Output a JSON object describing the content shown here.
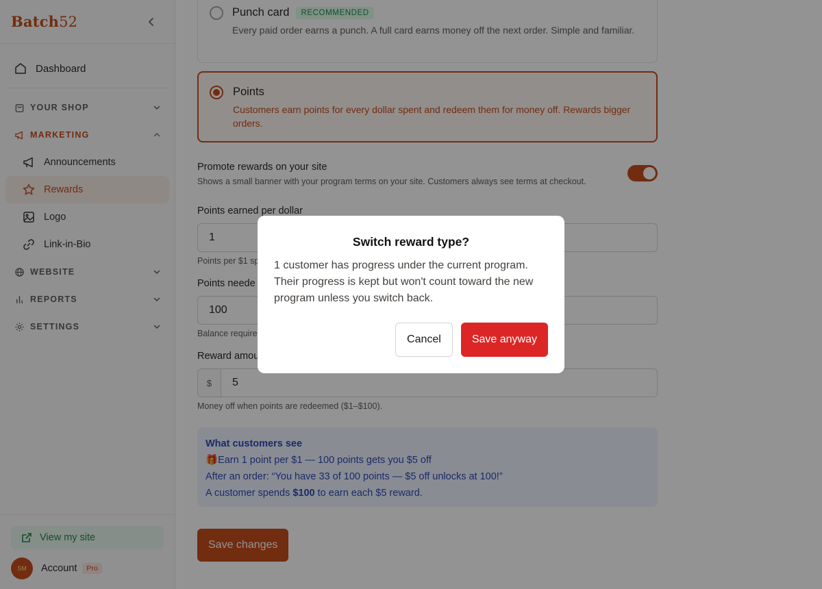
{
  "sidebar": {
    "brand": {
      "name": "Batch",
      "number": "52"
    },
    "dashboard_label": "Dashboard",
    "sections": {
      "your_shop": "YOUR SHOP",
      "marketing": "MARKETING",
      "website": "WEBSITE",
      "reports": "REPORTS",
      "settings": "SETTINGS"
    },
    "marketing_items": [
      "Announcements",
      "Rewards",
      "Logo",
      "Link-in-Bio"
    ],
    "active_item": "Rewards",
    "view_site_label": "View my site",
    "account": {
      "initials": "SM",
      "label": "Account",
      "badge": "Pro"
    }
  },
  "reward_types": {
    "punch": {
      "title": "Punch card",
      "badge": "RECOMMENDED",
      "description": "Every paid order earns a punch. A full card earns money off the next order. Simple and familiar.",
      "selected": false
    },
    "points": {
      "title": "Points",
      "description": "Customers earn points for every dollar spent and redeem them for money off. Rewards bigger orders.",
      "selected": true
    }
  },
  "promote": {
    "title": "Promote rewards on your site",
    "description": "Shows a small banner with your program terms on your site. Customers always see terms at checkout.",
    "enabled": true
  },
  "fields": {
    "points_per_dollar": {
      "label": "Points earned per dollar",
      "value": "1",
      "help": "Points per $1 sp"
    },
    "points_needed": {
      "label": "Points neede",
      "value": "100",
      "help": "Balance require"
    },
    "reward_amount": {
      "label": "Reward amou",
      "prefix": "$",
      "value": "5",
      "help": "Money off when points are redeemed ($1–$100)."
    }
  },
  "preview": {
    "title": "What customers see",
    "line1_emoji": "🎁",
    "line1": "Earn 1 point per $1 — 100 points gets you $5 off",
    "line2": "After an order: “You have 33 of 100 points — $5 off unlocks at 100!”",
    "line3_prefix": "A customer spends ",
    "line3_bold": "$100",
    "line3_suffix": " to earn each $5 reward."
  },
  "save_changes_label": "Save changes",
  "modal": {
    "title": "Switch reward type?",
    "body": "1 customer has progress under the current program. Their progress is kept but won't count toward the new program unless you switch back.",
    "cancel_label": "Cancel",
    "confirm_label": "Save anyway"
  },
  "colors": {
    "brand": "#c2410c",
    "danger": "#dc2626",
    "success": "#15803d",
    "preview_text": "#1e40af"
  }
}
